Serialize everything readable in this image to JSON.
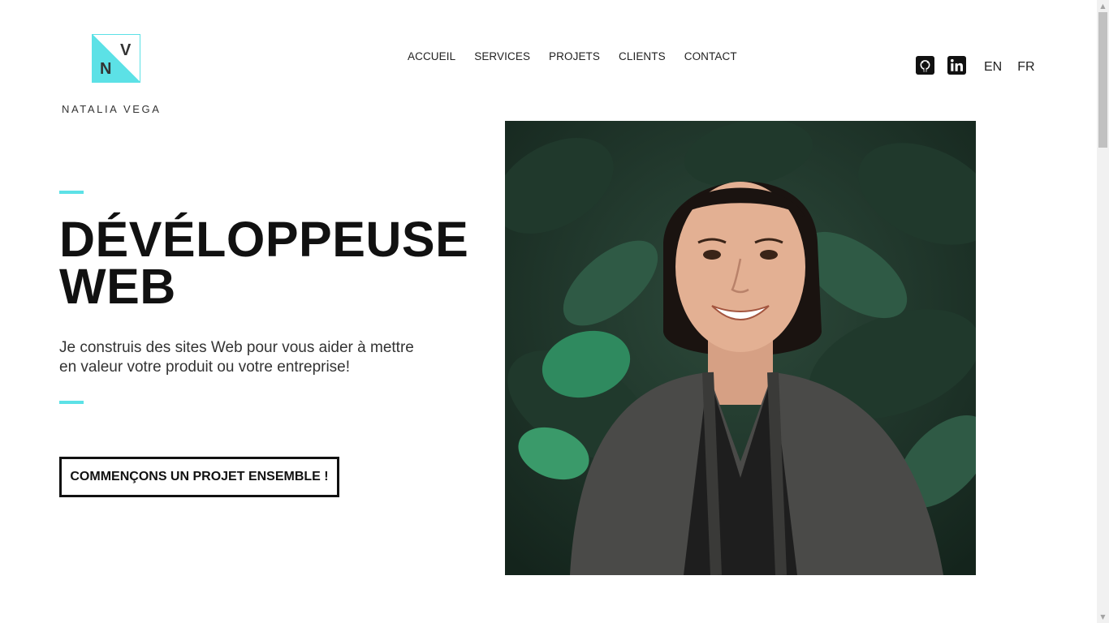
{
  "brand": {
    "initial_n": "N",
    "initial_v": "V",
    "name": "NATALIA VEGA",
    "accent_color": "#5ce1e6"
  },
  "nav": {
    "items": [
      {
        "label": "ACCUEIL"
      },
      {
        "label": "SERVICES"
      },
      {
        "label": "PROJETS"
      },
      {
        "label": "CLIENTS"
      },
      {
        "label": "CONTACT"
      }
    ]
  },
  "social": {
    "github_icon": "github-icon",
    "linkedin_icon": "linkedin-icon"
  },
  "languages": [
    "EN",
    "FR"
  ],
  "hero": {
    "title_line1": "DÉVÉLOPPEUSE",
    "title_line2": "WEB",
    "subtitle_line1": "Je construis des sites Web pour vous aider à mettre",
    "subtitle_line2": "en valeur votre produit ou votre entreprise!",
    "cta_label": "COMMENÇONS UN PROJET ENSEMBLE !"
  }
}
